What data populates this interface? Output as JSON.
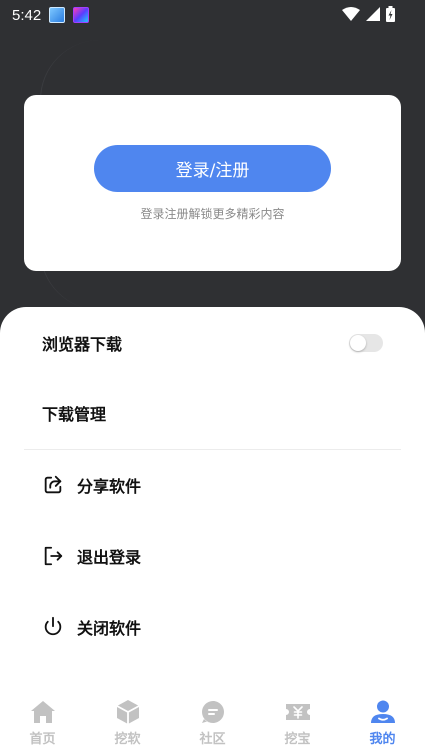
{
  "status_bar": {
    "time": "5:42"
  },
  "colors": {
    "accent": "#4f86ef",
    "background": "#2f3033",
    "inactive_tab": "#c2c2c2"
  },
  "login_card": {
    "button_label": "登录/注册",
    "hint": "登录注册解锁更多精彩内容"
  },
  "menu": {
    "browser_download": {
      "label": "浏览器下载",
      "toggle_on": false
    },
    "download_manager": {
      "label": "下载管理"
    },
    "share_app": {
      "label": "分享软件",
      "icon": "share-icon"
    },
    "logout": {
      "label": "退出登录",
      "icon": "logout-icon"
    },
    "close_app": {
      "label": "关闭软件",
      "icon": "power-icon"
    }
  },
  "bottom_nav": {
    "tabs": [
      {
        "label": "首页",
        "icon": "home-icon",
        "active": false
      },
      {
        "label": "挖软",
        "icon": "box-icon",
        "active": false
      },
      {
        "label": "社区",
        "icon": "chat-icon",
        "active": false
      },
      {
        "label": "挖宝",
        "icon": "ticket-icon",
        "active": false
      },
      {
        "label": "我的",
        "icon": "profile-icon",
        "active": true
      }
    ]
  }
}
